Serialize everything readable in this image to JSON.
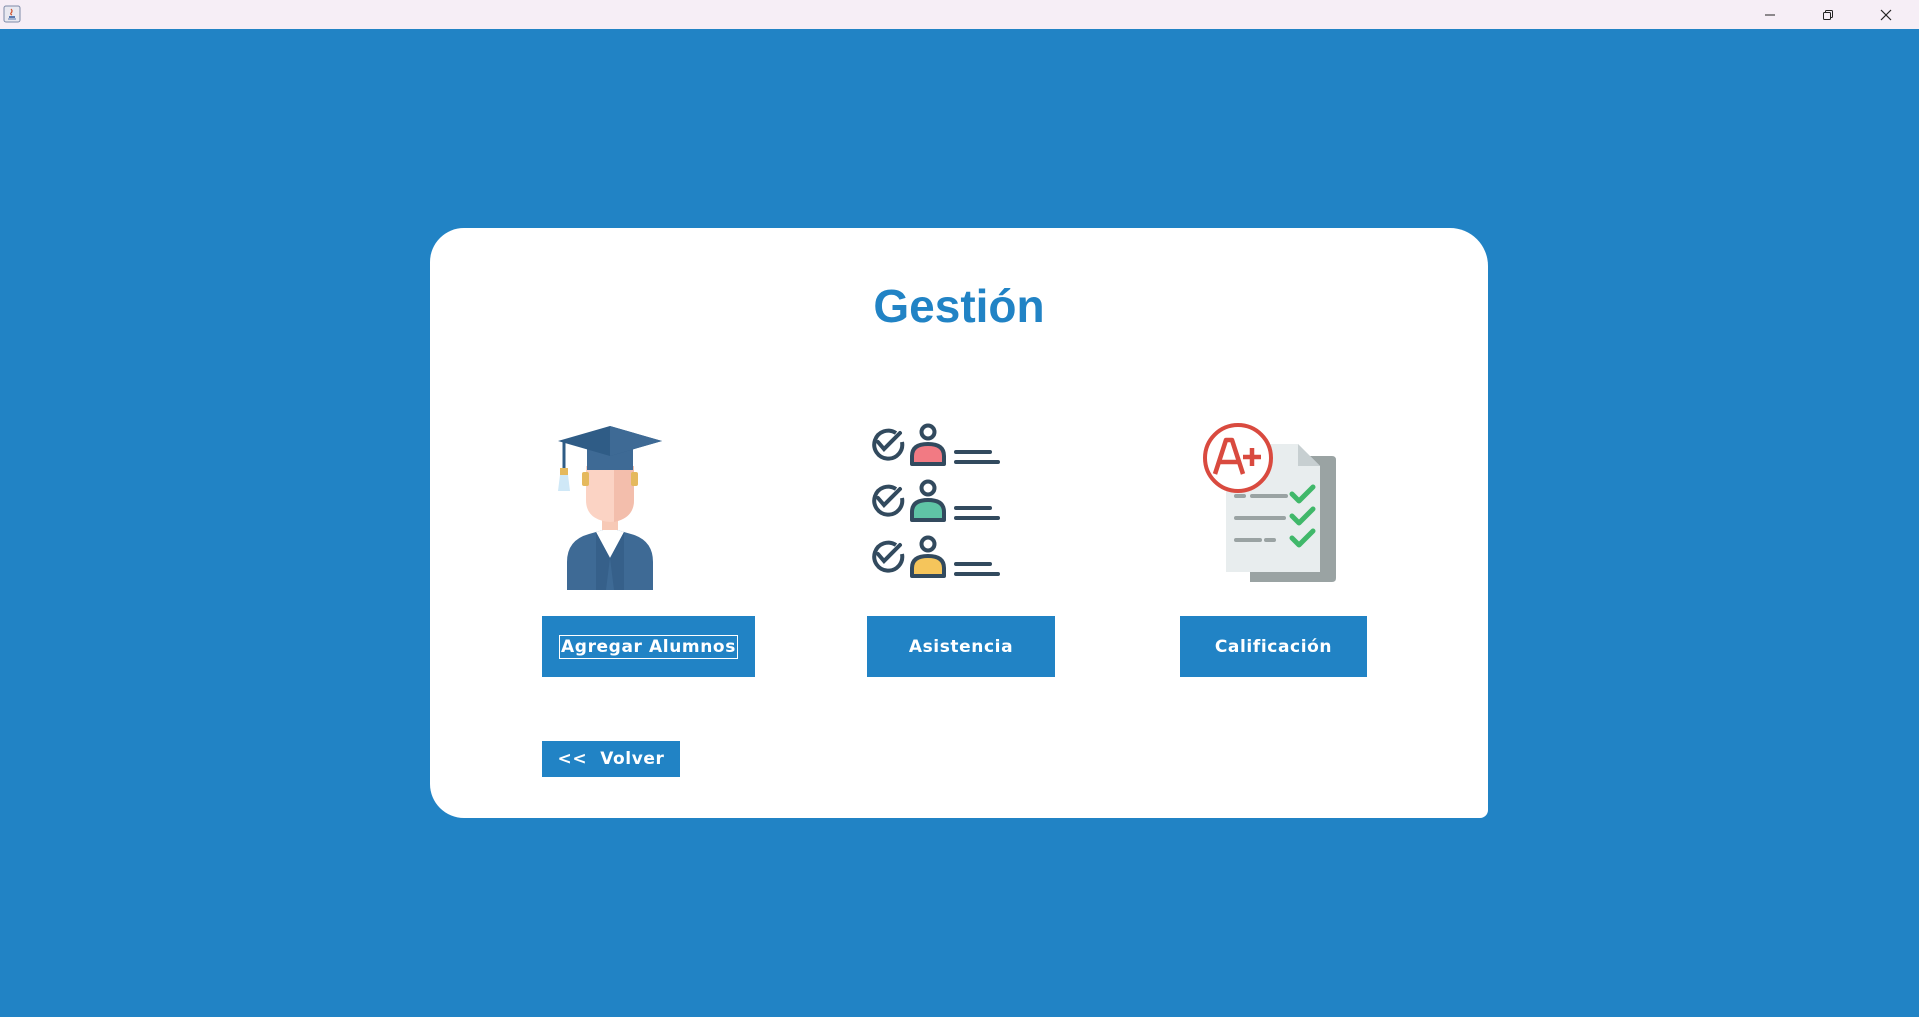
{
  "window": {
    "background_color": "#2183c5",
    "titlebar_color": "#f6eef6",
    "controls": {
      "minimize_icon": "minimize-icon",
      "maximize_icon": "restore-icon",
      "close_icon": "close-icon"
    }
  },
  "card": {
    "title": "Gestión",
    "title_color": "#2183c5",
    "items": [
      {
        "illustration": "graduate-student-icon",
        "button_label": "Agregar Alumnos"
      },
      {
        "illustration": "attendance-list-icon",
        "button_label": "Asistencia"
      },
      {
        "illustration": "grade-report-icon",
        "button_label": "Calificación"
      }
    ],
    "back_button_label": "<<  Volver",
    "button_color": "#2183c5"
  }
}
